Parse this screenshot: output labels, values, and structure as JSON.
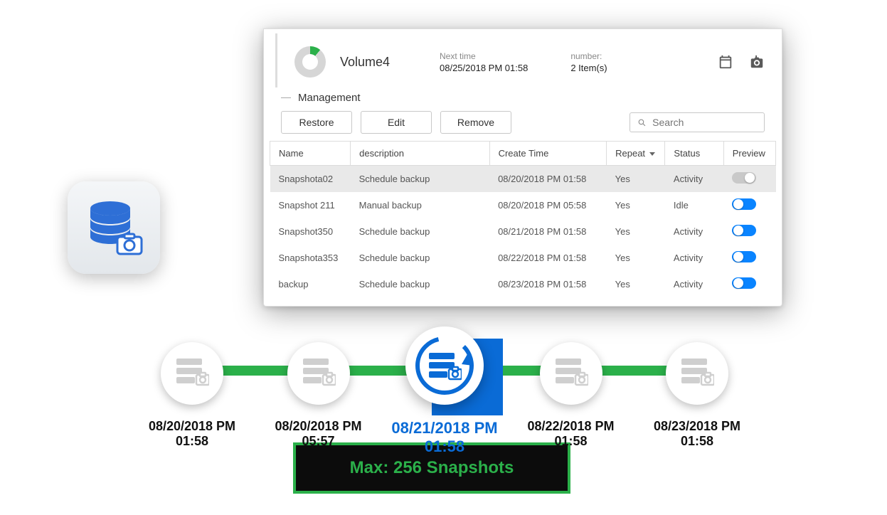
{
  "header": {
    "volume_name": "Volume4",
    "next_time_label": "Next time",
    "next_time_value": "08/25/2018 PM 01:58",
    "number_label": "number:",
    "number_value": "2 Item(s)"
  },
  "section_title": "Management",
  "toolbar": {
    "restore": "Restore",
    "edit": "Edit",
    "remove": "Remove",
    "search_placeholder": "Search"
  },
  "table": {
    "columns": {
      "name": "Name",
      "description": "description",
      "create_time": "Create Time",
      "repeat": "Repeat",
      "status": "Status",
      "preview": "Preview"
    },
    "rows": [
      {
        "name": "Snapshota02",
        "description": "Schedule backup",
        "create_time": "08/20/2018 PM 01:58",
        "repeat": "Yes",
        "status": "Activity",
        "status_class": "",
        "preview_on": false,
        "selected": true
      },
      {
        "name": "Snapshot 211",
        "description": "Manual backup",
        "create_time": "08/20/2018 PM 05:58",
        "repeat": "Yes",
        "status": "Idle",
        "status_class": "status-idle",
        "preview_on": true,
        "selected": false
      },
      {
        "name": "Snapshot350",
        "description": "Schedule backup",
        "create_time": "08/21/2018 PM 01:58",
        "repeat": "Yes",
        "status": "Activity",
        "status_class": "",
        "preview_on": true,
        "selected": false
      },
      {
        "name": "Snapshota353",
        "description": "Schedule backup",
        "create_time": "08/22/2018 PM 01:58",
        "repeat": "Yes",
        "status": "Activity",
        "status_class": "",
        "preview_on": true,
        "selected": false
      },
      {
        "name": "backup",
        "description": "Schedule backup",
        "create_time": "08/23/2018 PM 01:58",
        "repeat": "Yes",
        "status": "Activity",
        "status_class": "",
        "preview_on": true,
        "selected": false
      }
    ]
  },
  "timeline": {
    "nodes": [
      {
        "label": "08/20/2018 PM 01:58",
        "active": false
      },
      {
        "label": "08/20/2018 PM 05:57",
        "active": false
      },
      {
        "label": "08/21/2018 PM 01:58",
        "active": true
      },
      {
        "label": "08/22/2018 PM 01:58",
        "active": false
      },
      {
        "label": "08/23/2018 PM 01:58",
        "active": false
      }
    ]
  },
  "banner": {
    "text": "Max: 256 Snapshots"
  },
  "colors": {
    "accent_green": "#2bb04a",
    "accent_blue": "#0a6bd6",
    "toggle_blue": "#0a84ff"
  }
}
